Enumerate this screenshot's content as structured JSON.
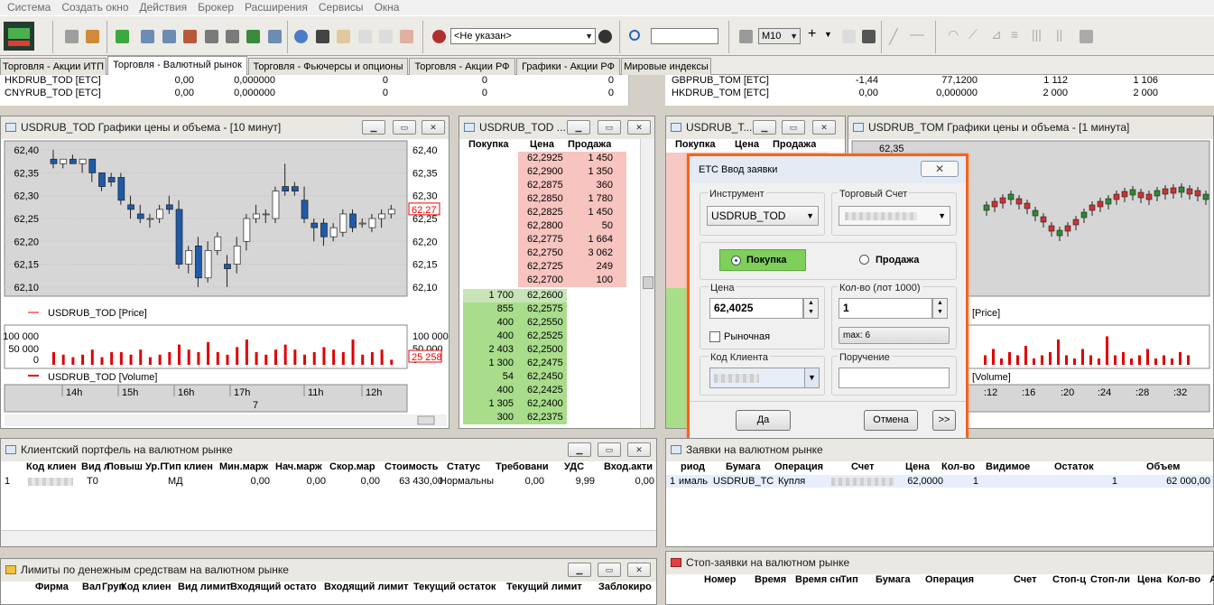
{
  "menu": [
    "Система",
    "Создать окно",
    "Действия",
    "Брокер",
    "Расширения",
    "Сервисы",
    "Окна"
  ],
  "toolbar": {
    "broker_select": "<Не указан>",
    "interval": "M10"
  },
  "tabs": [
    "Торговля - Акции ИТП",
    "Торговля - Валютный рынок",
    "Торговля - Фьючерсы и опционы",
    "Торговля - Акции РФ",
    "Графики - Акции РФ",
    "Мировые индексы"
  ],
  "top_left_rows": [
    {
      "name": "HKDRUB_TOD [ETC]",
      "c1": "0,00",
      "c2": "0,000000",
      "c3": "0",
      "c4": "0",
      "c5": "0"
    },
    {
      "name": "CNYRUB_TOD [ETC]",
      "c1": "0,00",
      "c2": "0,000000",
      "c3": "0",
      "c4": "0",
      "c5": "0"
    }
  ],
  "top_right_rows": [
    {
      "name": "GBPRUB_TOM [ETC]",
      "c1": "-1,44",
      "c2": "77,1200",
      "c3": "1 112",
      "c4": "1 106"
    },
    {
      "name": "HKDRUB_TOM [ETC]",
      "c1": "0,00",
      "c2": "0,000000",
      "c3": "2 000",
      "c4": "2 000"
    }
  ],
  "chart_left": {
    "title": "USDRUB_TOD Графики цены и объема - [10 минут]",
    "price_legend": "USDRUB_TOD [Price]",
    "volume_legend": "USDRUB_TOD [Volume]",
    "y_ticks": [
      "62,40",
      "62,35",
      "62,30",
      "62,25",
      "62,20",
      "62,15",
      "62,10"
    ],
    "last_price": "62,27",
    "vol_ticks": [
      "100 000",
      "50 000",
      "0"
    ],
    "last_volume": "25 258",
    "x_ticks": [
      "14h",
      "15h",
      "16h",
      "17h",
      "11h",
      "12h"
    ],
    "date_label": "7"
  },
  "chart_data": [
    {
      "type": "candlestick",
      "title": "USDRUB_TOD Графики цены и объема - [10 минут]",
      "ylim": [
        62.08,
        62.42
      ],
      "candles": [
        {
          "o": 62.38,
          "h": 62.4,
          "l": 62.36,
          "c": 62.37
        },
        {
          "o": 62.37,
          "h": 62.38,
          "l": 62.36,
          "c": 62.38
        },
        {
          "o": 62.38,
          "h": 62.39,
          "l": 62.37,
          "c": 62.37
        },
        {
          "o": 62.37,
          "h": 62.38,
          "l": 62.35,
          "c": 62.38
        },
        {
          "o": 62.38,
          "h": 62.38,
          "l": 62.33,
          "c": 62.35
        },
        {
          "o": 62.35,
          "h": 62.35,
          "l": 62.31,
          "c": 62.32
        },
        {
          "o": 62.34,
          "h": 62.35,
          "l": 62.32,
          "c": 62.33
        },
        {
          "o": 62.34,
          "h": 62.35,
          "l": 62.28,
          "c": 62.29
        },
        {
          "o": 62.28,
          "h": 62.3,
          "l": 62.25,
          "c": 62.27
        },
        {
          "o": 62.26,
          "h": 62.28,
          "l": 62.24,
          "c": 62.25
        },
        {
          "o": 62.25,
          "h": 62.26,
          "l": 62.23,
          "c": 62.25
        },
        {
          "o": 62.25,
          "h": 62.28,
          "l": 62.24,
          "c": 62.27
        },
        {
          "o": 62.28,
          "h": 62.3,
          "l": 62.26,
          "c": 62.27
        },
        {
          "o": 62.27,
          "h": 62.29,
          "l": 62.14,
          "c": 62.15
        },
        {
          "o": 62.15,
          "h": 62.19,
          "l": 62.13,
          "c": 62.18
        },
        {
          "o": 62.19,
          "h": 62.21,
          "l": 62.1,
          "c": 62.12
        },
        {
          "o": 62.12,
          "h": 62.2,
          "l": 62.11,
          "c": 62.18
        },
        {
          "o": 62.18,
          "h": 62.22,
          "l": 62.17,
          "c": 62.21
        },
        {
          "o": 62.15,
          "h": 62.17,
          "l": 62.1,
          "c": 62.14
        },
        {
          "o": 62.15,
          "h": 62.21,
          "l": 62.13,
          "c": 62.19
        },
        {
          "o": 62.2,
          "h": 62.26,
          "l": 62.18,
          "c": 62.25
        },
        {
          "o": 62.25,
          "h": 62.28,
          "l": 62.24,
          "c": 62.26
        },
        {
          "o": 62.26,
          "h": 62.27,
          "l": 62.24,
          "c": 62.26
        },
        {
          "o": 62.25,
          "h": 62.32,
          "l": 62.24,
          "c": 62.31
        },
        {
          "o": 62.32,
          "h": 62.37,
          "l": 62.3,
          "c": 62.31
        },
        {
          "o": 62.32,
          "h": 62.33,
          "l": 62.3,
          "c": 62.31
        },
        {
          "o": 62.29,
          "h": 62.32,
          "l": 62.24,
          "c": 62.25
        },
        {
          "o": 62.24,
          "h": 62.25,
          "l": 62.2,
          "c": 62.23
        },
        {
          "o": 62.24,
          "h": 62.25,
          "l": 62.19,
          "c": 62.21
        },
        {
          "o": 62.21,
          "h": 62.24,
          "l": 62.2,
          "c": 62.23
        },
        {
          "o": 62.22,
          "h": 62.27,
          "l": 62.21,
          "c": 62.26
        },
        {
          "o": 62.26,
          "h": 62.27,
          "l": 62.22,
          "c": 62.23
        },
        {
          "o": 62.24,
          "h": 62.25,
          "l": 62.23,
          "c": 62.24
        },
        {
          "o": 62.23,
          "h": 62.26,
          "l": 62.22,
          "c": 62.25
        },
        {
          "o": 62.25,
          "h": 62.27,
          "l": 62.23,
          "c": 62.26
        },
        {
          "o": 62.26,
          "h": 62.28,
          "l": 62.25,
          "c": 62.27
        }
      ],
      "volume": [
        5,
        4,
        3,
        4,
        6,
        3,
        5,
        5,
        4,
        6,
        3,
        4,
        5,
        8,
        6,
        5,
        9,
        5,
        4,
        7,
        10,
        5,
        4,
        6,
        8,
        6,
        4,
        5,
        7,
        6,
        5,
        10,
        4,
        5,
        6,
        2
      ]
    }
  ],
  "orderbook": {
    "title": "USDRUB_TOD ...",
    "headers": [
      "Покупка",
      "Цена",
      "Продажа"
    ],
    "asks": [
      [
        "62,2925",
        "1 450"
      ],
      [
        "62,2900",
        "1 350"
      ],
      [
        "62,2875",
        "360"
      ],
      [
        "62,2850",
        "1 780"
      ],
      [
        "62,2825",
        "1 450"
      ],
      [
        "62,2800",
        "50"
      ],
      [
        "62,2775",
        "1 664"
      ],
      [
        "62,2750",
        "3 062"
      ],
      [
        "62,2725",
        "249"
      ],
      [
        "62,2700",
        "100"
      ]
    ],
    "bids": [
      [
        "1 700",
        "62,2600"
      ],
      [
        "855",
        "62,2575"
      ],
      [
        "400",
        "62,2550"
      ],
      [
        "400",
        "62,2525"
      ],
      [
        "2 403",
        "62,2500"
      ],
      [
        "1 300",
        "62,2475"
      ],
      [
        "54",
        "62,2450"
      ],
      [
        "400",
        "62,2425"
      ],
      [
        "1 305",
        "62,2400"
      ],
      [
        "300",
        "62,2375"
      ]
    ]
  },
  "orderbook2": {
    "title": "USDRUB_T...",
    "headers": [
      "Покупка",
      "Цена",
      "Продажа"
    ]
  },
  "chart_right": {
    "title": "USDRUB_TOM Графики цены и объема - [1 минута]",
    "top_price": "62,35",
    "price_legend": "[Price]",
    "volume_legend": "[Volume]",
    "x_ticks": [
      ":12",
      ":16",
      ":20",
      ":24",
      ":28",
      ":32"
    ]
  },
  "dialog": {
    "title": "ETC Ввод заявки",
    "instrument_label": "Инструмент",
    "instrument": "USDRUB_TOD",
    "account_label": "Торговый Счет",
    "buy": "Покупка",
    "sell": "Продажа",
    "price_label": "Цена",
    "price": "62,4025",
    "qty_label": "Кол-во (лот 1000)",
    "qty": "1",
    "market_label": "Рыночная",
    "max_label": "max: 6",
    "client_label": "Код Клиента",
    "order_label": "Поручение",
    "ok": "Да",
    "cancel": "Отмена",
    "more": ">>"
  },
  "portfolio": {
    "title": "Клиентский портфель на валютном рынке",
    "headers": [
      "Код клиен",
      "Вид л",
      "Повыш",
      "Ур.Г",
      "Тип клиен",
      "Мин.марж",
      "Нач.марж",
      "Скор.мар",
      "Стоимость",
      "Статус",
      "Требовани",
      "УДС",
      "Вход.акти"
    ],
    "row": {
      "n": "1",
      "vid": "Т0",
      "tip": "МД",
      "min": "0,00",
      "nach": "0,00",
      "skor": "0,00",
      "stoim": "63 430,00",
      "status": "Нормальны",
      "treb": "0,00",
      "uds": "9,99",
      "vhod": "0,00"
    }
  },
  "orders": {
    "title": "Заявки на валютном рынке",
    "headers": [
      "риод",
      "Бумага",
      "Операция",
      "Счет",
      "Цена",
      "Кол-во",
      "Видимое",
      "Остаток",
      "Объем"
    ],
    "row": {
      "n": "1",
      "period": "ималь",
      "bumaga": "USDRUB_TC",
      "op": "Купля",
      "price": "62,0000",
      "qty": "1",
      "ost": "1",
      "vol": "62 000,00"
    }
  },
  "limits": {
    "title": "Лимиты по денежным средствам на валютном рынке",
    "headers": [
      "Фирма",
      "Вал",
      "Груп",
      "Код клиен",
      "Вид лимит",
      "Входящий остато",
      "Входящий лимит",
      "Текущий остаток",
      "Текущий лимит",
      "Заблокиро"
    ]
  },
  "stops": {
    "title": "Стоп-заявки на валютном рынке",
    "headers": [
      "Номер",
      "Время",
      "Время сн",
      "Тип",
      "Бумага",
      "Операция",
      "Счет",
      "Стоп-ц",
      "Стоп-ли",
      "Цена",
      "Кол-во",
      "А"
    ]
  }
}
